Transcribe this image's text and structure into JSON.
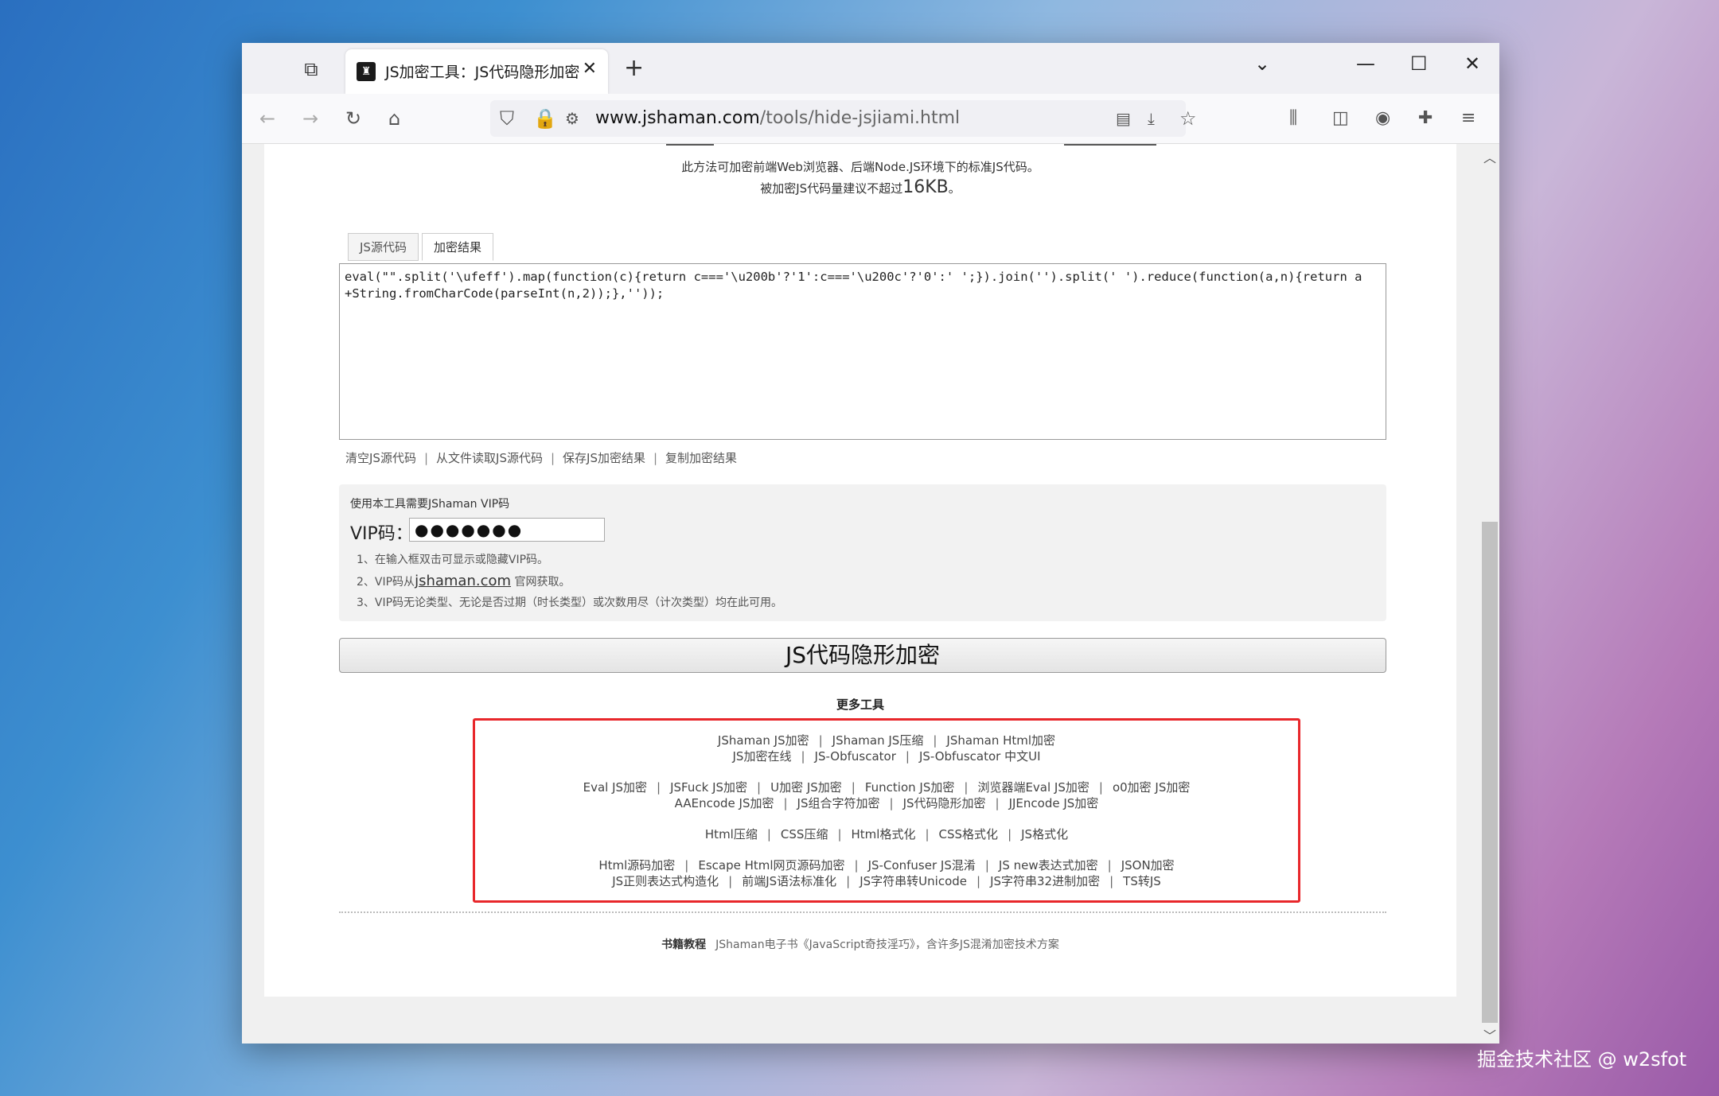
{
  "browser": {
    "tab_title": "JS加密工具：JS代码隐形加密",
    "url_domain": "www.jshaman.com",
    "url_path": "/tools/hide-jsjiami.html"
  },
  "page": {
    "desc1": "此方法可加密前端Web浏览器、后端Node.JS环境下的标准JS代码。",
    "desc2_prefix": "被加密JS代码量建议不超过",
    "desc2_size": "16KB",
    "desc2_suffix": "。",
    "tabs": [
      "JS源代码",
      "加密结果"
    ],
    "code": "eval(\"‍‌​‍\".split('\\ufeff').map(function(c){return c==='\\u200b'?'1':c==='\\u200c'?'0':' ';}).join('').split(' ').reduce(function(a,n){return a+String.fromCharCode(parseInt(n,2));},''));",
    "code_display": "eval(\"\".split('\\ufeff').map(function(c){return c==='\\u200b'?'1':c==='\\u200c'?'0':' ';}).join('').split(' ').reduce(function(a,n){return a\n+String.fromCharCode(parseInt(n,2));},''));",
    "actions": [
      "清空JS源代码",
      "从文件读取JS源代码",
      "保存JS加密结果",
      "复制加密结果"
    ],
    "vip_title": "使用本工具需要JShaman VIP码",
    "vip_label": "VIP码：",
    "vip_value": "●●●●●●●",
    "vip_note1": "1、在输入框双击可显示或隐藏VIP码。",
    "vip_note2_prefix": "2、VIP码从",
    "vip_note2_link": "jshaman.com",
    "vip_note2_suffix": "官网获取。",
    "vip_note3": "3、VIP码无论类型、无论是否过期（时长类型）或次数用尽（计次类型）均在此可用。",
    "encrypt_button": "JS代码隐形加密",
    "more_tools_title": "更多工具",
    "tool_groups": [
      [
        [
          "JShaman JS加密",
          "JShaman JS压缩",
          "JShaman Html加密"
        ],
        [
          "JS加密在线",
          "JS-Obfuscator",
          "JS-Obfuscator 中文UI"
        ]
      ],
      [
        [
          "Eval JS加密",
          "JSFuck JS加密",
          "U加密 JS加密",
          "Function JS加密",
          "浏览器端Eval JS加密",
          "o0加密 JS加密"
        ],
        [
          "AAEncode JS加密",
          "JS组合字符加密",
          "JS代码隐形加密",
          "JJEncode JS加密"
        ]
      ],
      [
        [
          "Html压缩",
          "CSS压缩",
          "Html格式化",
          "CSS格式化",
          "JS格式化"
        ]
      ],
      [
        [
          "Html源码加密",
          "Escape Html网页源码加密",
          "JS-Confuser JS混淆",
          "JS new表达式加密",
          "JSON加密"
        ],
        [
          "JS正则表达式构造化",
          "前端JS语法标准化",
          "JS字符串转Unicode",
          "JS字符串32进制加密",
          "TS转JS"
        ]
      ]
    ],
    "footer_label": "书籍教程",
    "footer_text": "JShaman电子书《JavaScript奇技淫巧》，含许多JS混淆加密技术方案"
  },
  "watermark": "掘金技术社区 @ w2sfot"
}
